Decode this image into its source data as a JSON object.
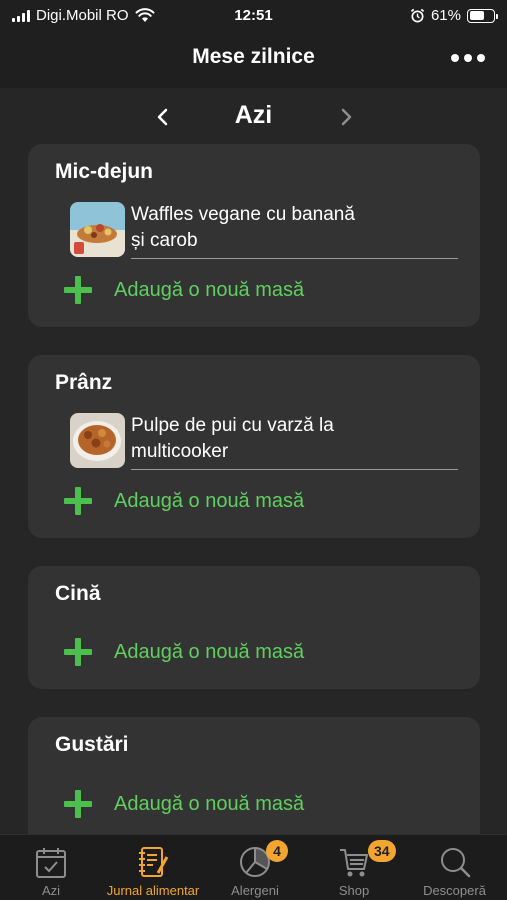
{
  "status": {
    "carrier": "Digi.Mobil RO",
    "time": "12:51",
    "battery": "61%",
    "battery_level": 0.61,
    "icons": [
      "signal-icon",
      "wifi-icon",
      "alarm-icon",
      "battery-icon"
    ]
  },
  "header": {
    "title": "Mese zilnice",
    "more_icon": "ellipsis-icon"
  },
  "date_nav": {
    "label": "Azi",
    "prev_icon": "chevron-left-icon",
    "next_icon": "chevron-right-icon"
  },
  "meals": [
    {
      "title": "Mic-dejun",
      "items": [
        {
          "line1": "Waffles vegane cu banană",
          "line2": "și carob"
        }
      ],
      "add_label": "Adaugă o nouă masă"
    },
    {
      "title": "Prânz",
      "items": [
        {
          "line1": "Pulpe de pui cu varză la",
          "line2": "multicooker"
        }
      ],
      "add_label": "Adaugă o nouă masă"
    },
    {
      "title": "Cină",
      "items": [],
      "add_label": "Adaugă o nouă masă"
    },
    {
      "title": "Gustări",
      "items": [],
      "add_label": "Adaugă o nouă masă"
    }
  ],
  "tabs": [
    {
      "label": "Azi",
      "icon": "calendar-check-icon",
      "active": false
    },
    {
      "label": "Jurnal alimentar",
      "icon": "journal-icon",
      "active": true
    },
    {
      "label": "Alergeni",
      "icon": "allergen-chart-icon",
      "badge": "4"
    },
    {
      "label": "Shop",
      "icon": "shop-cart-icon",
      "badge": "34"
    },
    {
      "label": "Descoperă",
      "icon": "search-icon"
    }
  ],
  "colors": {
    "accent_green": "#5fcf5f",
    "accent_orange": "#f2a531",
    "card_bg": "#333333",
    "bg": "#262626"
  }
}
